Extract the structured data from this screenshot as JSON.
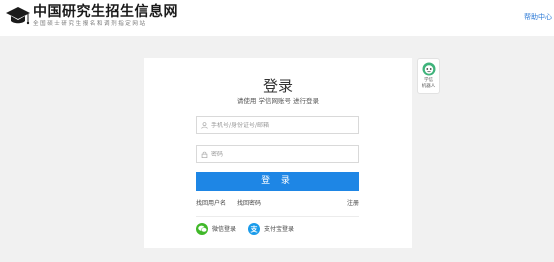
{
  "header": {
    "logo_title": "中国研究生招生信息网",
    "logo_subtitle": "全国硕士研究生报名和调剂指定网站",
    "help_link": "帮助中心"
  },
  "login": {
    "title": "登录",
    "subtitle": "请使用 学信网账号 进行登录",
    "username_placeholder": "手机号/身份证号/邮箱",
    "username_value": "",
    "password_placeholder": "密码",
    "password_value": "",
    "submit_label": "登 录",
    "find_username": "找回用户名",
    "find_password": "找回密码",
    "register": "注册",
    "wechat_login": "微信登录",
    "alipay_login": "支付宝登录"
  },
  "robot": {
    "line1": "学信",
    "line2": "机器人"
  },
  "colors": {
    "accent": "#1e86e5",
    "link": "#2b79d6",
    "wechat": "#40b829",
    "alipay": "#1a9bea",
    "background": "#f1f1f1"
  },
  "icons": [
    "graduation-cap-icon",
    "user-icon",
    "lock-icon",
    "wechat-icon",
    "alipay-icon",
    "robot-icon"
  ]
}
